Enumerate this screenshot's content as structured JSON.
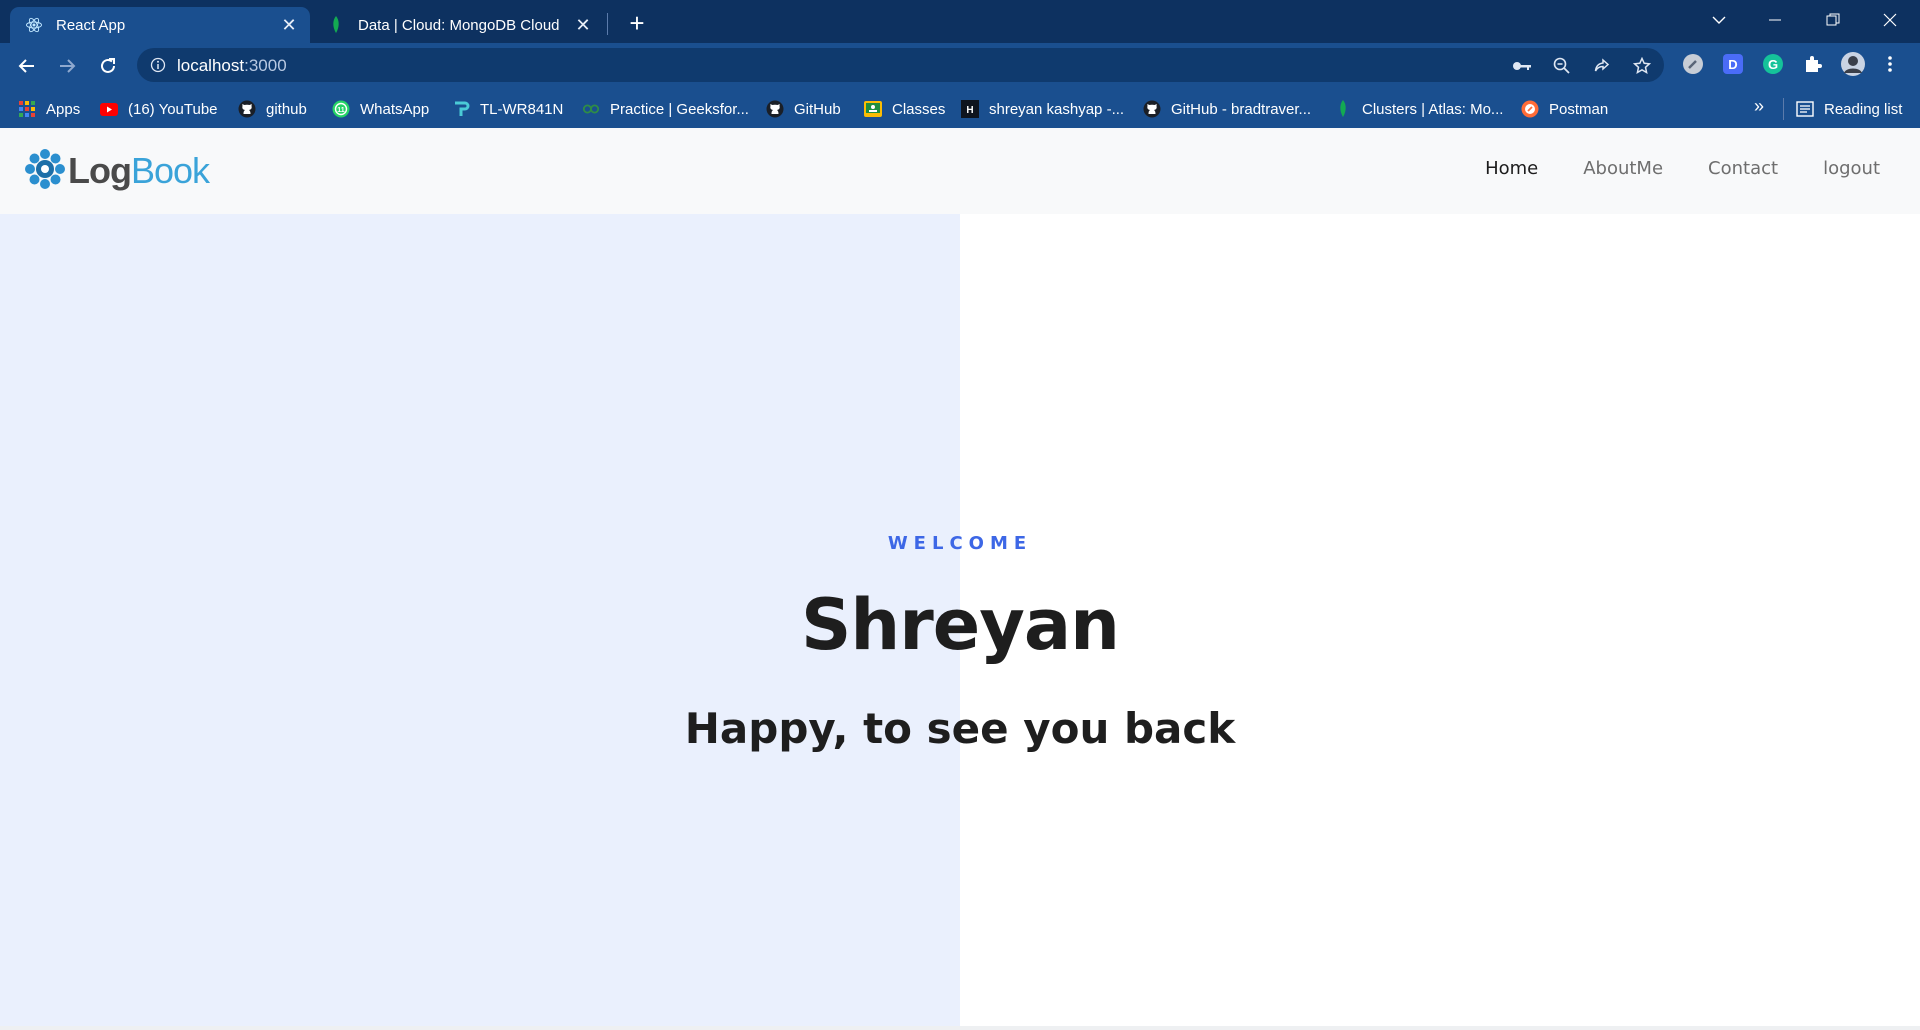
{
  "browser": {
    "tabs": [
      {
        "title": "React App",
        "active": true,
        "icon": "react-icon"
      },
      {
        "title": "Data | Cloud: MongoDB Cloud",
        "active": false,
        "icon": "mongodb-leaf-icon"
      }
    ],
    "address": {
      "host": "localhost",
      "port": ":3000"
    },
    "bookmarks": [
      {
        "label": "Apps",
        "icon": "apps-grid-icon"
      },
      {
        "label": "(16) YouTube",
        "icon": "youtube-icon"
      },
      {
        "label": "github",
        "icon": "github-icon"
      },
      {
        "label": "WhatsApp",
        "icon": "whatsapp-icon"
      },
      {
        "label": "TL-WR841N",
        "icon": "tplink-icon"
      },
      {
        "label": "Practice | Geeksfor...",
        "icon": "geeksforgeeks-icon"
      },
      {
        "label": "GitHub",
        "icon": "github-icon"
      },
      {
        "label": "Classes",
        "icon": "classroom-icon"
      },
      {
        "label": "shreyan kashyap -...",
        "icon": "hackerrank-icon"
      },
      {
        "label": "GitHub - bradtraver...",
        "icon": "github-icon"
      },
      {
        "label": "Clusters | Atlas: Mo...",
        "icon": "mongodb-leaf-icon"
      },
      {
        "label": "Postman",
        "icon": "postman-icon"
      }
    ],
    "more_bookmarks": "»",
    "reading_list": "Reading list",
    "colors": {
      "tabstrip": "#0d3160",
      "toolbar": "#1a4f8f"
    }
  },
  "app": {
    "brand": {
      "part1": "Log",
      "part2": "Book"
    },
    "nav": [
      {
        "label": "Home",
        "active": true
      },
      {
        "label": "AboutMe",
        "active": false
      },
      {
        "label": "Contact",
        "active": false
      },
      {
        "label": "logout",
        "active": false
      }
    ],
    "hero": {
      "eyebrow": "WELCOME",
      "name": "Shreyan",
      "tagline": "Happy, to see you back"
    },
    "colors": {
      "accent": "#3d67e6",
      "hero_left_bg": "#eaf0fd",
      "brand_blue": "#3aa3d9"
    }
  }
}
